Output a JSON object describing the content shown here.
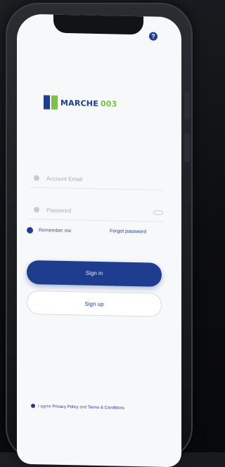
{
  "help": {
    "glyph": "?"
  },
  "logo": {
    "name": "MARCHE",
    "accent": "003"
  },
  "login": {
    "email_placeholder": "Account Email",
    "password_placeholder": "Password"
  },
  "options": {
    "remember_label": "Remember me",
    "forgot_label": "Forgot password"
  },
  "buttons": {
    "sign_in": "Sign in",
    "sign_up": "Sign up"
  },
  "terms": {
    "prefix": "I agree",
    "privacy": "Privacy Policy",
    "and": "and",
    "terms": "Terms & Conditions"
  },
  "colors": {
    "primary": "#1e3d8f",
    "accent": "#7cc242"
  }
}
